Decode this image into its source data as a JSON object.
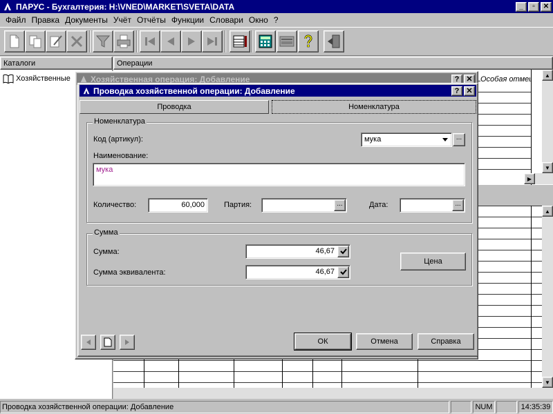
{
  "window": {
    "title": "ПАРУС - Бухгалтерия: H:\\VNED\\MARKET\\SVETA\\DATA"
  },
  "menu": [
    "Файл",
    "Правка",
    "Документы",
    "Учёт",
    "Отчёты",
    "Функции",
    "Словари",
    "Окно",
    "?"
  ],
  "panels": {
    "left_header": "Каталоги",
    "right_header": "Операции"
  },
  "tree": {
    "item": "Хозяйственные"
  },
  "grid": {
    "italic_header": "Особая отметка"
  },
  "back_dialog": {
    "title": "Хозяйственная операция: Добавление"
  },
  "dialog": {
    "title": "Проводка хозяйственной операции: Добавление",
    "tabs": [
      "Проводка",
      "Номенклатура"
    ],
    "nomenclature": {
      "group_title": "Номенклатура",
      "code_label": "Код (артикул):",
      "code_value": "мука",
      "name_label": "Наименование:",
      "name_value": "мука",
      "qty_label": "Количество:",
      "qty_value": "60,000",
      "batch_label": "Партия:",
      "batch_value": "",
      "date_label": "Дата:",
      "date_value": ""
    },
    "sum": {
      "group_title": "Сумма",
      "sum_label": "Сумма:",
      "sum_value": "46,67",
      "equiv_label": "Сумма эквивалента:",
      "equiv_value": "46,67",
      "price_button": "Цена"
    },
    "buttons": {
      "ok": "ОК",
      "cancel": "Отмена",
      "help": "Справка"
    }
  },
  "status": {
    "text": "Проводка хозяйственной операции: Добавление",
    "num": "NUM",
    "time": "14:35:39"
  },
  "colors": {
    "title_active": "#000080",
    "title_inactive": "#808080",
    "face": "#c0c0c0",
    "name_text": "#a0208f"
  }
}
